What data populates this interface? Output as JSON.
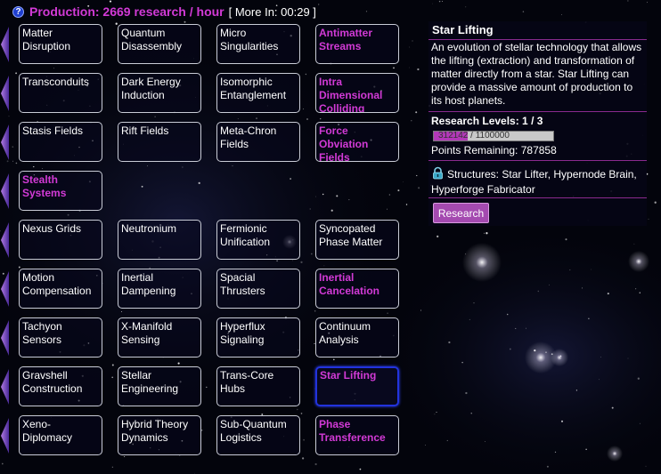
{
  "header": {
    "help_icon": "?",
    "production": "Production: 2669 research / hour",
    "more_in": "[ More In: 00:29 ]"
  },
  "colors": {
    "available": "#d23ad6",
    "selected_border": "#2233dd",
    "arrow": "#8b4bc6",
    "button": "#a44ab0"
  },
  "rows": [
    {
      "tiles": [
        {
          "label": "Matter Disruption",
          "available": false
        },
        {
          "label": "Quantum Disassembly",
          "available": false
        },
        {
          "label": "Micro Singularities",
          "available": false
        },
        {
          "label": "Antimatter Streams",
          "available": true
        }
      ]
    },
    {
      "tiles": [
        {
          "label": "Transconduits",
          "available": false
        },
        {
          "label": "Dark Energy Induction",
          "available": false
        },
        {
          "label": "Isomorphic Entanglement",
          "available": false
        },
        {
          "label": "Intra Dimensional Colliding",
          "available": true
        }
      ]
    },
    {
      "tiles": [
        {
          "label": "Stasis Fields",
          "available": false
        },
        {
          "label": "Rift Fields",
          "available": false
        },
        {
          "label": "Meta-Chron Fields",
          "available": false
        },
        {
          "label": "Force Obviation Fields",
          "available": true
        }
      ]
    },
    {
      "tiles": [
        {
          "label": "Stealth Systems",
          "available": true
        }
      ]
    },
    {
      "tiles": [
        {
          "label": "Nexus Grids",
          "available": false
        },
        {
          "label": "Neutronium",
          "available": false
        },
        {
          "label": "Fermionic Unification",
          "available": false
        },
        {
          "label": "Syncopated Phase Matter",
          "available": false
        }
      ]
    },
    {
      "tiles": [
        {
          "label": "Motion Compensation",
          "available": false
        },
        {
          "label": "Inertial Dampening",
          "available": false
        },
        {
          "label": "Spacial Thrusters",
          "available": false
        },
        {
          "label": "Inertial Cancelation",
          "available": true
        }
      ]
    },
    {
      "tiles": [
        {
          "label": "Tachyon Sensors",
          "available": false
        },
        {
          "label": "X-Manifold Sensing",
          "available": false
        },
        {
          "label": "Hyperflux Signaling",
          "available": false
        },
        {
          "label": "Continuum Analysis",
          "available": false
        }
      ]
    },
    {
      "tiles": [
        {
          "label": "Gravshell Construction",
          "available": false
        },
        {
          "label": "Stellar Engineering",
          "available": false
        },
        {
          "label": "Trans-Core Hubs",
          "available": false
        },
        {
          "label": "Star Lifting",
          "available": true,
          "selected": true
        }
      ]
    },
    {
      "tiles": [
        {
          "label": "Xeno-Diplomacy",
          "available": false
        },
        {
          "label": "Hybrid Theory Dynamics",
          "available": false
        },
        {
          "label": "Sub-Quantum Logistics",
          "available": false
        },
        {
          "label": "Phase Transference",
          "available": true
        }
      ]
    }
  ],
  "detail": {
    "title": "Star Lifting",
    "description": "An evolution of stellar technology that allows the lifting (extraction) and transformation of matter directly from a star. Star Lifting can provide a massive amount of production to its host planets.",
    "levels_label": "Research Levels: 1 / 3",
    "progress_text": "312142 / 1100000",
    "progress_fraction": 0.2838,
    "points_remaining": "Points Remaining: 787858",
    "lock_icon": "lock-icon",
    "structures": "Structures: Star Lifter, Hypernode Brain, Hyperforge Fabricator",
    "button_label": "Research"
  }
}
